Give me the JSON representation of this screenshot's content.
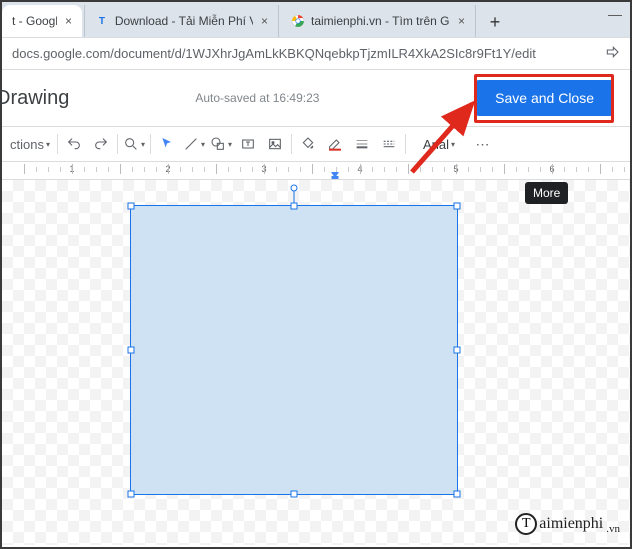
{
  "browser": {
    "tabs": [
      {
        "title": "t - Google I",
        "favicon": "docs"
      },
      {
        "title": "Download - Tải Miễn Phí VN",
        "favicon": "T"
      },
      {
        "title": "taimienphi.vn - Tìm trên Goo",
        "favicon": "G"
      }
    ],
    "url": "docs.google.com/document/d/1WJXhrJgAmLkKBKQNqebkpTjzmILR4XkA2SIc8r9Ft1Y/edit"
  },
  "dialog": {
    "title": "Drawing",
    "autosaved": "Auto-saved at 16:49:23",
    "save_close": "Save and Close"
  },
  "toolbar": {
    "actions_label": "ctions",
    "font": "Arial",
    "more_tooltip": "More"
  },
  "ruler": {
    "nums": [
      "1",
      "2",
      "3",
      "4",
      "5",
      "6"
    ]
  },
  "watermark": {
    "icon": "T",
    "text": "aimienphi",
    "suffix": ".vn"
  }
}
